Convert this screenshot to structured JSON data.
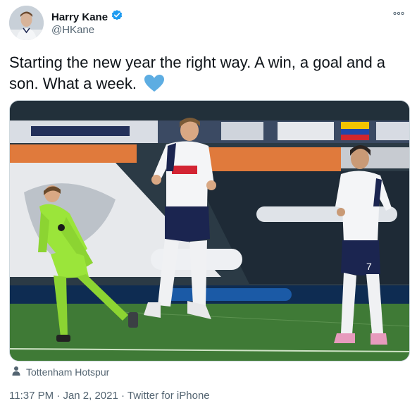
{
  "author": {
    "name": "Harry Kane",
    "handle": "@HKane",
    "verified": true,
    "avatar": "profile-photo"
  },
  "more_icon": "more-options-icon",
  "tweet": {
    "text": "Starting the new year the right way. A win, a goal and a son. What a week.",
    "emoji": "blue-heart"
  },
  "media": {
    "kind": "photo",
    "jersey_number": "7",
    "tag_icon": "person-tag-icon",
    "tagged": "Tottenham Hotspur"
  },
  "meta": {
    "time": "11:37 PM",
    "separator": "·",
    "date": "Jan 2, 2021",
    "source": "Twitter for iPhone"
  },
  "colors": {
    "verified": "#1d9bf0",
    "heart": "#5dade2",
    "secondary_text": "#536471",
    "pitch": "#3f7a36",
    "keeper_kit": "#9be53a"
  }
}
